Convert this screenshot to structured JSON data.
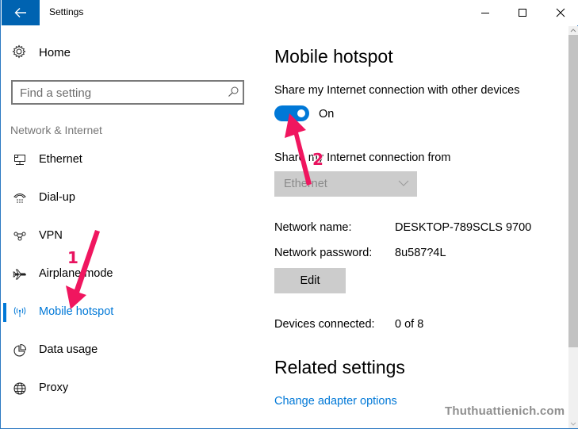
{
  "window": {
    "title": "Settings",
    "accent_color": "#0078d7",
    "back_icon": "arrow-left-icon",
    "controls": [
      "minimize-icon",
      "maximize-icon",
      "close-icon"
    ]
  },
  "sidebar": {
    "home_label": "Home",
    "home_icon": "gear-icon",
    "search": {
      "placeholder": "Find a setting",
      "value": "",
      "icon": "search-icon"
    },
    "section_heading": "Network & Internet",
    "items": [
      {
        "label": "Ethernet",
        "icon": "ethernet-icon",
        "selected": false
      },
      {
        "label": "Dial-up",
        "icon": "dial-up-icon",
        "selected": false
      },
      {
        "label": "VPN",
        "icon": "vpn-icon",
        "selected": false
      },
      {
        "label": "Airplane mode",
        "icon": "airplane-icon",
        "selected": false
      },
      {
        "label": "Mobile hotspot",
        "icon": "hotspot-icon",
        "selected": true
      },
      {
        "label": "Data usage",
        "icon": "data-usage-icon",
        "selected": false
      },
      {
        "label": "Proxy",
        "icon": "globe-icon",
        "selected": false
      }
    ]
  },
  "main": {
    "title": "Mobile hotspot",
    "share_label": "Share my Internet connection with other devices",
    "toggle": {
      "state": "On",
      "on": true
    },
    "share_from_label": "Share my Internet connection from",
    "share_from_dropdown": {
      "value": "Ethernet",
      "disabled": true
    },
    "network_name_label": "Network name:",
    "network_name_value": "DESKTOP-789SCLS 9700",
    "network_password_label": "Network password:",
    "network_password_value": "8u587?4L",
    "edit_label": "Edit",
    "devices_connected_label": "Devices connected:",
    "devices_connected_value": "0 of 8",
    "related_title": "Related settings",
    "related_link": "Change adapter options"
  },
  "annotations": {
    "step1": "1",
    "step2": "2",
    "arrow_color": "#f0165f"
  },
  "watermark": "Thuthuattienich.com"
}
